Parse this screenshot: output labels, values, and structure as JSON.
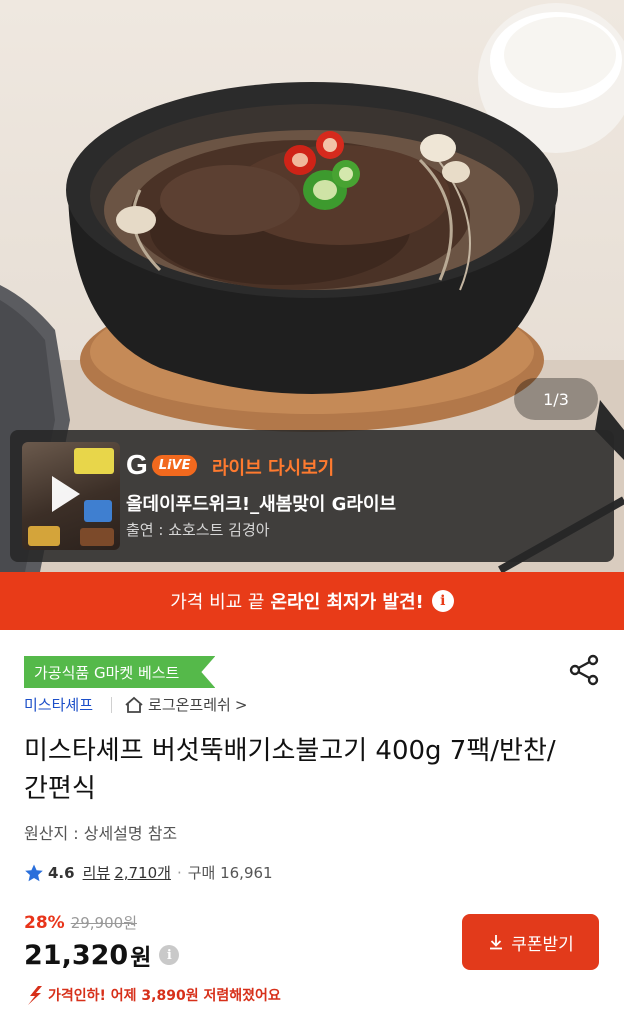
{
  "hero": {
    "page_indicator": "1/3"
  },
  "live": {
    "logo_letter": "G",
    "logo_pill": "LiVE",
    "title": "라이브 다시보기",
    "subtitle": "올데이푸드위크!_새봄맞이 G라이브",
    "host": "출연 : 쇼호스트 김경아"
  },
  "promo": {
    "text_plain": "가격 비교 끝",
    "text_bold": "온라인 최저가 발견!",
    "info_glyph": "i"
  },
  "product": {
    "badge": "가공식품 G마켓 베스트",
    "brand": "미스타셰프",
    "store": "로그온프레쉬",
    "store_chevron": ">",
    "title": "미스타셰프 버섯뚝배기소불고기 400g 7팩/반찬/간편식",
    "origin": "원산지 : 상세설명 참조",
    "rating": "4.6",
    "review_label": "리뷰",
    "review_count": "2,710개",
    "purchase": "구매 16,961",
    "discount": "28%",
    "original_price": "29,900원",
    "sale_price": "21,320",
    "sale_unit": "원",
    "price_info_glyph": "i",
    "coupon_button": "쿠폰받기",
    "price_drop": "가격인하! 어제 3,890원 저렴해졌어요"
  },
  "colors": {
    "promo_red": "#e83b18",
    "coupon_red": "#e23a1b",
    "badge_green": "#55b94a",
    "brand_blue": "#1c4fc9",
    "live_orange": "#ff7a2f",
    "star_blue": "#2a6fdb"
  },
  "icons": [
    "share-icon",
    "home-icon",
    "star-icon",
    "download-icon",
    "down-arrow-icon",
    "play-icon",
    "info-icon"
  ]
}
